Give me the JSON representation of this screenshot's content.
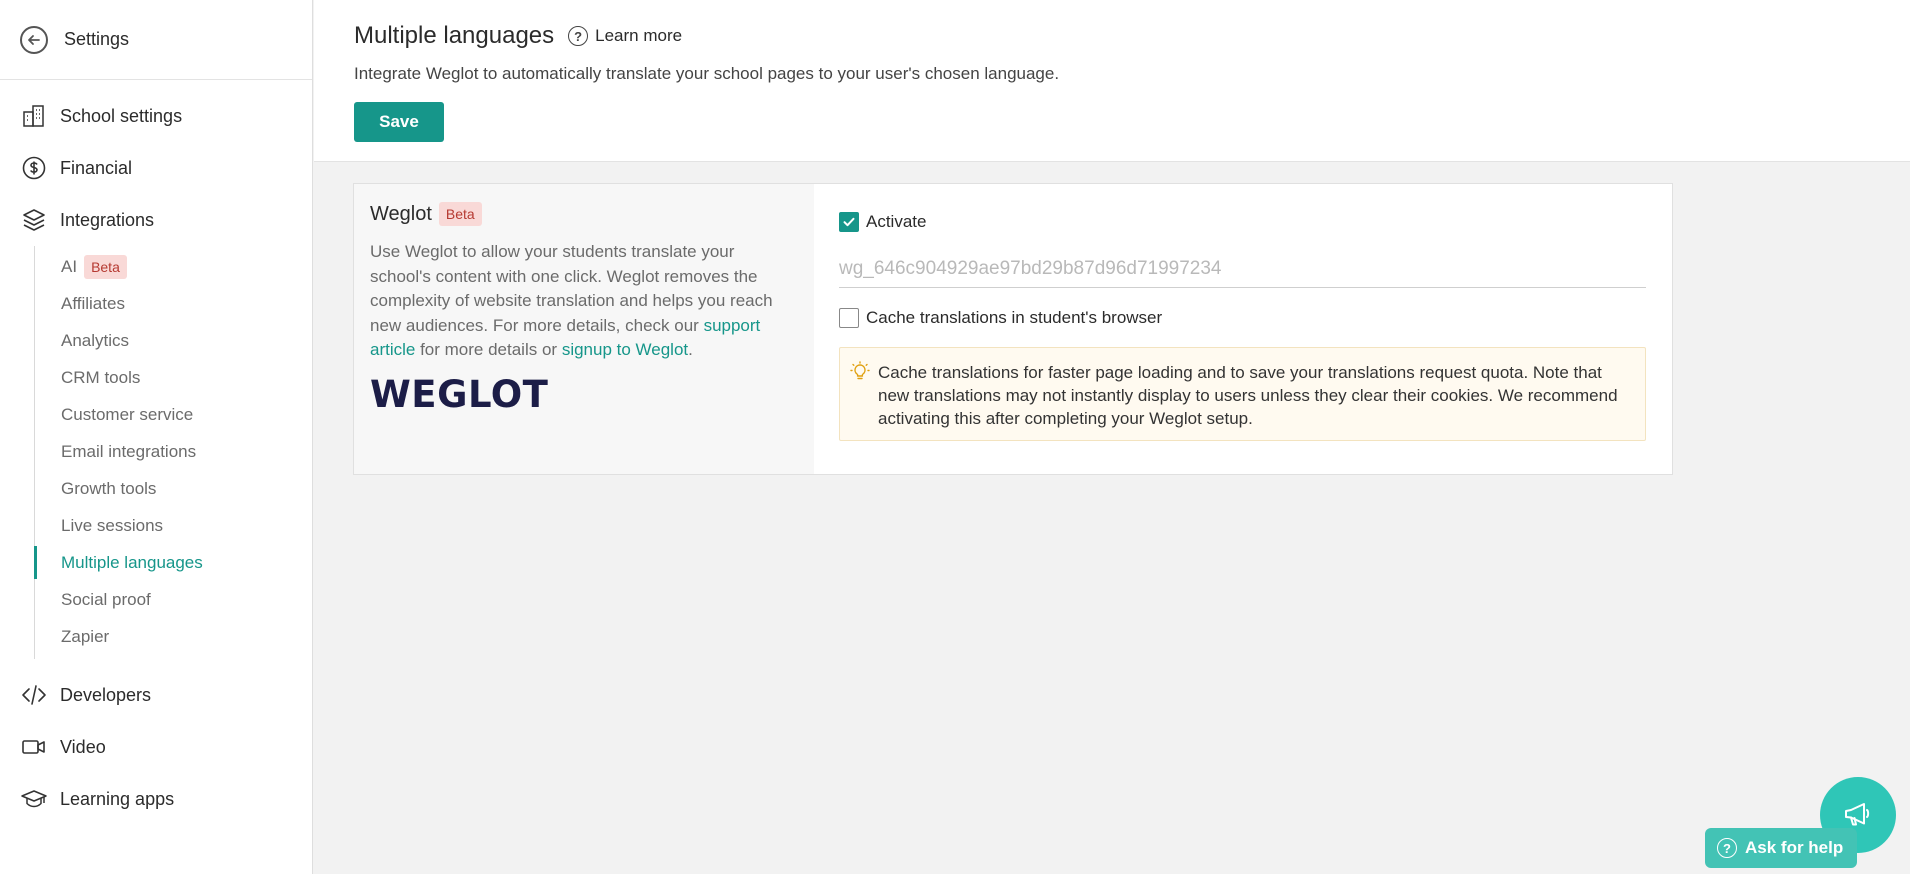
{
  "sidebar": {
    "back_label": "Settings",
    "top_items": [
      {
        "label": "School settings",
        "icon": "building-icon"
      },
      {
        "label": "Financial",
        "icon": "dollar-circle-icon"
      },
      {
        "label": "Integrations",
        "icon": "layers-icon"
      }
    ],
    "integrations": {
      "items": [
        {
          "label": "AI",
          "badge": "Beta"
        },
        {
          "label": "Affiliates"
        },
        {
          "label": "Analytics"
        },
        {
          "label": "CRM tools"
        },
        {
          "label": "Customer service"
        },
        {
          "label": "Email integrations"
        },
        {
          "label": "Growth tools"
        },
        {
          "label": "Live sessions"
        },
        {
          "label": "Multiple languages",
          "active": true
        },
        {
          "label": "Social proof"
        },
        {
          "label": "Zapier"
        }
      ]
    },
    "bottom_items": [
      {
        "label": "Developers",
        "icon": "code-icon"
      },
      {
        "label": "Video",
        "icon": "video-camera-icon"
      },
      {
        "label": "Learning apps",
        "icon": "graduation-cap-icon"
      }
    ]
  },
  "header": {
    "title": "Multiple languages",
    "learn_more": "Learn more",
    "description": "Integrate Weglot to automatically translate your school pages to your user's chosen language.",
    "save_label": "Save"
  },
  "weglot": {
    "title": "Weglot",
    "badge": "Beta",
    "description_start": "Use Weglot to allow your students translate your school's content with one click. Weglot removes the complexity of website translation and helps you reach new audiences. For more details, check our ",
    "link_support": "support article",
    "description_mid": " for more details or ",
    "link_signup": "signup to Weglot",
    "description_end": ".",
    "logo_text": "WEGLOT",
    "activate_label": "Activate",
    "activate_checked": true,
    "api_key_value": "wg_646c904929ae97bd29b87d96d71997234",
    "cache_label": "Cache translations in student's browser",
    "cache_checked": false,
    "notice": "Cache translations for faster page loading and to save your translations request quota. Note that new translations may not instantly display to users unless they clear their cookies. We recommend activating this after completing your Weglot setup."
  },
  "help": {
    "ask_label": "Ask for help"
  },
  "colors": {
    "accent": "#16968a",
    "badge_bg": "#f9d9d7",
    "badge_text": "#b63a32",
    "notice_bg": "#fffaf0",
    "fab": "#2fc6b7"
  }
}
